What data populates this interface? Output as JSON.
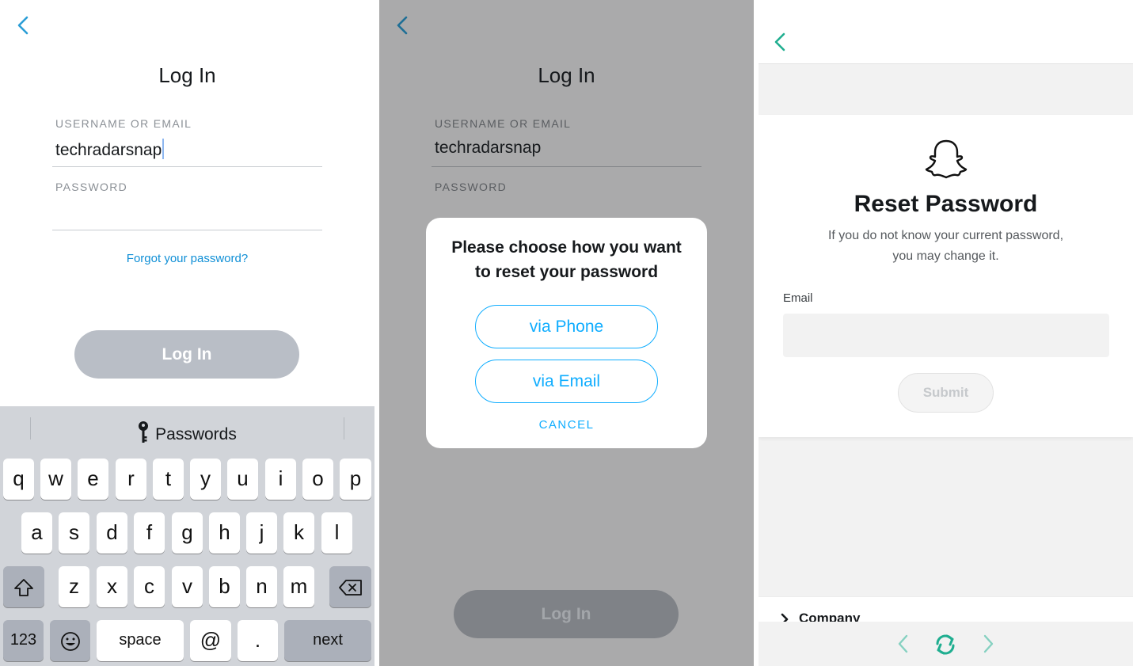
{
  "login_screen": {
    "title": "Log In",
    "username_label": "USERNAME OR EMAIL",
    "username_value": "techradarsnap",
    "password_label": "PASSWORD",
    "forgot_link": "Forgot your password?",
    "login_button": "Log In",
    "button_color": "#b9bec6"
  },
  "keyboard": {
    "suggestion": "Passwords",
    "row1": [
      "q",
      "w",
      "e",
      "r",
      "t",
      "y",
      "u",
      "i",
      "o",
      "p"
    ],
    "row2": [
      "a",
      "s",
      "d",
      "f",
      "g",
      "h",
      "j",
      "k",
      "l"
    ],
    "row3": [
      "z",
      "x",
      "c",
      "v",
      "b",
      "n",
      "m"
    ],
    "numbers_key": "123",
    "space_key": "space",
    "at_key": "@",
    "period_key": ".",
    "next_key": "next",
    "icons": [
      "key-icon",
      "shift-icon",
      "delete-icon",
      "emoji-icon"
    ]
  },
  "reset_dialog_screen": {
    "title": "Log In",
    "username_label": "USERNAME OR EMAIL",
    "username_value": "techradarsnap",
    "password_label": "PASSWORD",
    "dialog": {
      "title": "Please choose how you want to reset your password",
      "via_phone": "via Phone",
      "via_email": "via Email",
      "cancel": "CANCEL",
      "accent_color": "#0fadff"
    },
    "login_button": "Log In",
    "button_color": "#7f8287"
  },
  "reset_password_page": {
    "title": "Reset Password",
    "subtitle_line1": "If you do not know your current password,",
    "subtitle_line2": "you may change it.",
    "email_label": "Email",
    "email_value": "",
    "submit_button": "Submit",
    "footer_section": "Company",
    "icons": [
      "back-icon",
      "ghost-logo-icon",
      "browser-back-icon",
      "refresh-icon",
      "browser-forward-icon"
    ],
    "accent_color": "#1fae90"
  }
}
